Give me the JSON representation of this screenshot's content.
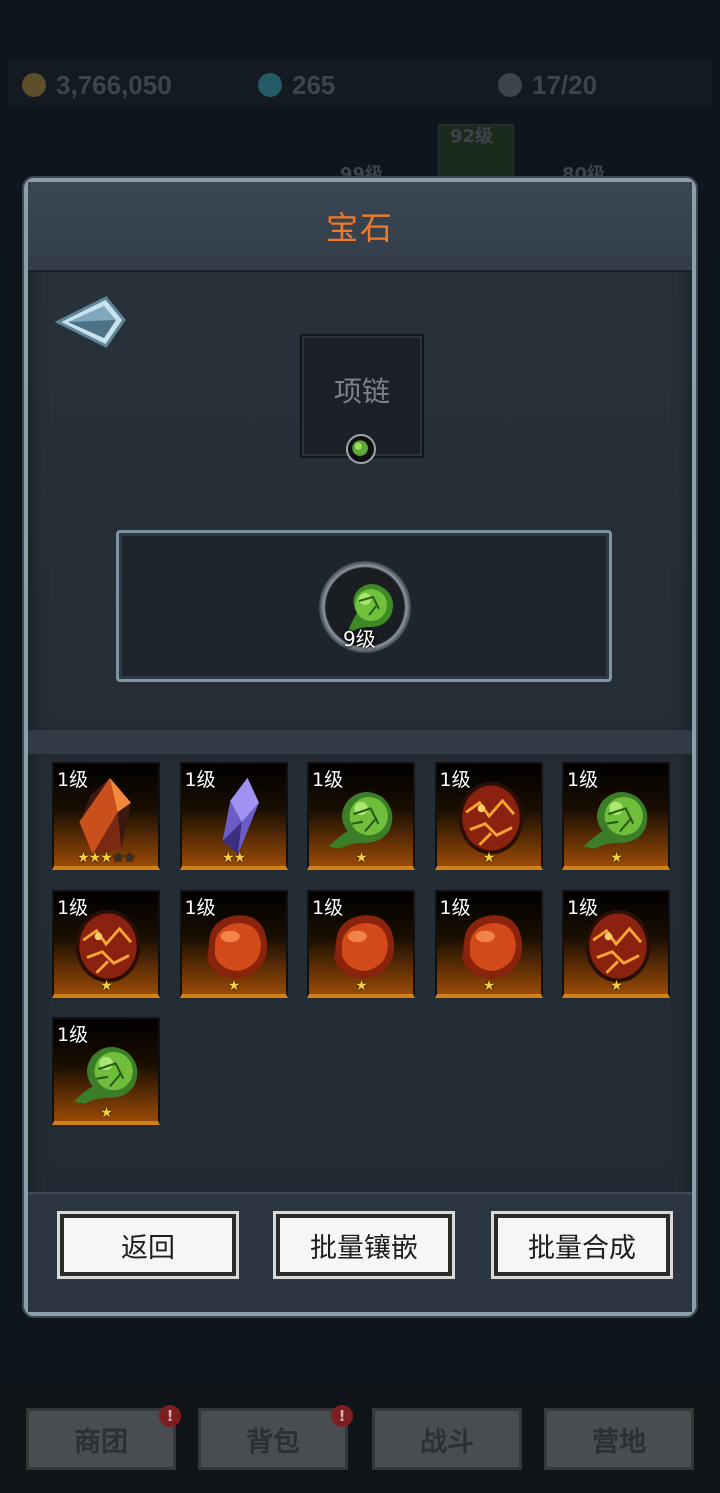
{
  "resources": {
    "gold": "3,766,050",
    "diamonds": "265",
    "scrolls": "17/20"
  },
  "background_tags": [
    "92级",
    "99级",
    "80级"
  ],
  "bottom_tabs": [
    {
      "label": "商团",
      "badge": "!"
    },
    {
      "label": "背包",
      "badge": "!"
    },
    {
      "label": "战斗",
      "badge": ""
    },
    {
      "label": "营地",
      "badge": ""
    }
  ],
  "dialog": {
    "title": "宝石",
    "equipment_slot": "项链",
    "socket_level": "9级"
  },
  "gems": [
    {
      "level": "1级",
      "type": "fire-crystal",
      "stars": 3,
      "max_stars": 5
    },
    {
      "level": "1级",
      "type": "amethyst",
      "stars": 2,
      "max_stars": 2
    },
    {
      "level": "1级",
      "type": "green-gem",
      "stars": 1,
      "max_stars": 1
    },
    {
      "level": "1级",
      "type": "lava-egg",
      "stars": 1,
      "max_stars": 1
    },
    {
      "level": "1级",
      "type": "green-gem",
      "stars": 1,
      "max_stars": 1
    },
    {
      "level": "1级",
      "type": "lava-egg",
      "stars": 1,
      "max_stars": 1
    },
    {
      "level": "1级",
      "type": "red-gem",
      "stars": 1,
      "max_stars": 1
    },
    {
      "level": "1级",
      "type": "red-gem",
      "stars": 1,
      "max_stars": 1
    },
    {
      "level": "1级",
      "type": "red-gem",
      "stars": 1,
      "max_stars": 1
    },
    {
      "level": "1级",
      "type": "lava-egg",
      "stars": 1,
      "max_stars": 1
    },
    {
      "level": "1级",
      "type": "green-gem",
      "stars": 1,
      "max_stars": 1
    }
  ],
  "buttons": {
    "back": "返回",
    "batch_inlay": "批量镶嵌",
    "batch_compose": "批量合成"
  }
}
